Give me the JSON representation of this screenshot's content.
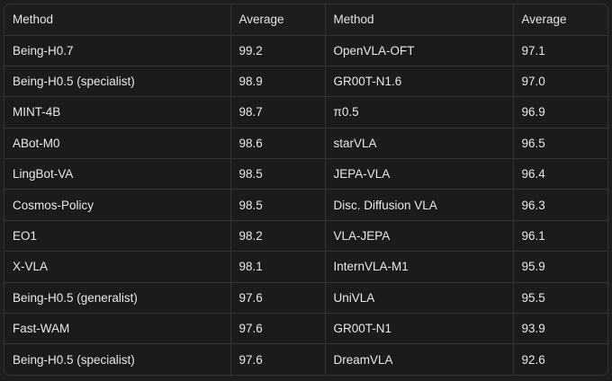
{
  "table": {
    "headers": [
      "Method",
      "Average",
      "Method",
      "Average"
    ],
    "rows": [
      [
        "Being-H0.7",
        "99.2",
        "OpenVLA-OFT",
        "97.1"
      ],
      [
        "Being-H0.5 (specialist)",
        "98.9",
        "GR00T-N1.6",
        "97.0"
      ],
      [
        "MINT-4B",
        "98.7",
        "π0.5",
        "96.9"
      ],
      [
        "ABot-M0",
        "98.6",
        "starVLA",
        "96.5"
      ],
      [
        "LingBot-VA",
        "98.5",
        "JEPA-VLA",
        "96.4"
      ],
      [
        "Cosmos-Policy",
        "98.5",
        "Disc. Diffusion VLA",
        "96.3"
      ],
      [
        "EO1",
        "98.2",
        "VLA-JEPA",
        "96.1"
      ],
      [
        "X-VLA",
        "98.1",
        "InternVLA-M1",
        "95.9"
      ],
      [
        "Being-H0.5 (generalist)",
        "97.6",
        "UniVLA",
        "95.5"
      ],
      [
        "Fast-WAM",
        "97.6",
        "GR00T-N1",
        "93.9"
      ],
      [
        "Being-H0.5 (specialist)",
        "97.6",
        "DreamVLA",
        "92.6"
      ]
    ]
  }
}
